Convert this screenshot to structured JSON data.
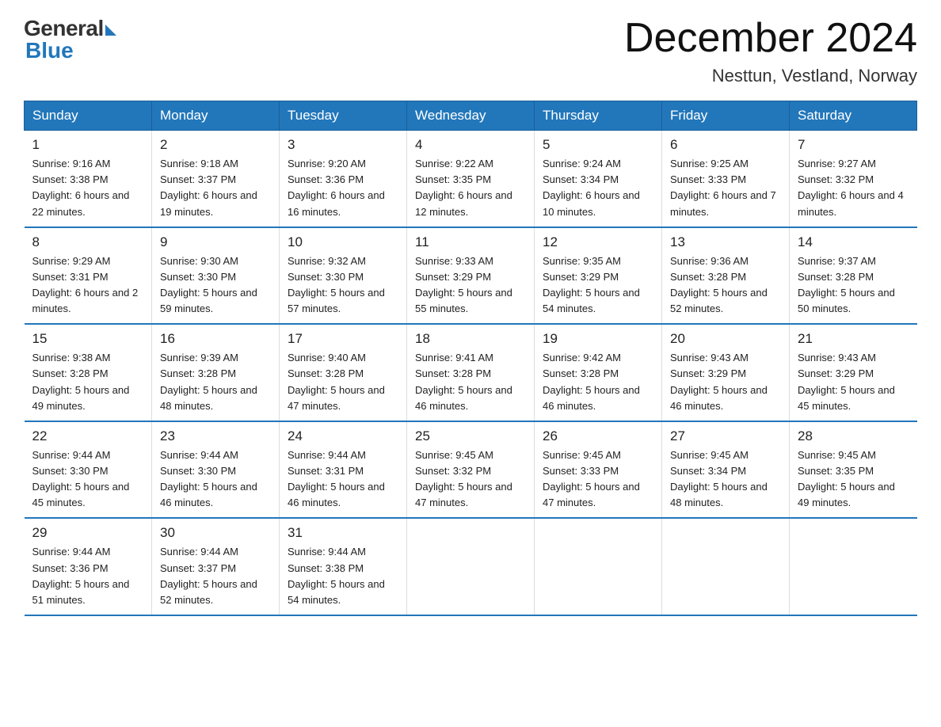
{
  "logo": {
    "general": "General",
    "blue": "Blue"
  },
  "title": "December 2024",
  "subtitle": "Nesttun, Vestland, Norway",
  "days_of_week": [
    "Sunday",
    "Monday",
    "Tuesday",
    "Wednesday",
    "Thursday",
    "Friday",
    "Saturday"
  ],
  "weeks": [
    [
      {
        "num": "1",
        "sunrise": "9:16 AM",
        "sunset": "3:38 PM",
        "daylight": "6 hours and 22 minutes."
      },
      {
        "num": "2",
        "sunrise": "9:18 AM",
        "sunset": "3:37 PM",
        "daylight": "6 hours and 19 minutes."
      },
      {
        "num": "3",
        "sunrise": "9:20 AM",
        "sunset": "3:36 PM",
        "daylight": "6 hours and 16 minutes."
      },
      {
        "num": "4",
        "sunrise": "9:22 AM",
        "sunset": "3:35 PM",
        "daylight": "6 hours and 12 minutes."
      },
      {
        "num": "5",
        "sunrise": "9:24 AM",
        "sunset": "3:34 PM",
        "daylight": "6 hours and 10 minutes."
      },
      {
        "num": "6",
        "sunrise": "9:25 AM",
        "sunset": "3:33 PM",
        "daylight": "6 hours and 7 minutes."
      },
      {
        "num": "7",
        "sunrise": "9:27 AM",
        "sunset": "3:32 PM",
        "daylight": "6 hours and 4 minutes."
      }
    ],
    [
      {
        "num": "8",
        "sunrise": "9:29 AM",
        "sunset": "3:31 PM",
        "daylight": "6 hours and 2 minutes."
      },
      {
        "num": "9",
        "sunrise": "9:30 AM",
        "sunset": "3:30 PM",
        "daylight": "5 hours and 59 minutes."
      },
      {
        "num": "10",
        "sunrise": "9:32 AM",
        "sunset": "3:30 PM",
        "daylight": "5 hours and 57 minutes."
      },
      {
        "num": "11",
        "sunrise": "9:33 AM",
        "sunset": "3:29 PM",
        "daylight": "5 hours and 55 minutes."
      },
      {
        "num": "12",
        "sunrise": "9:35 AM",
        "sunset": "3:29 PM",
        "daylight": "5 hours and 54 minutes."
      },
      {
        "num": "13",
        "sunrise": "9:36 AM",
        "sunset": "3:28 PM",
        "daylight": "5 hours and 52 minutes."
      },
      {
        "num": "14",
        "sunrise": "9:37 AM",
        "sunset": "3:28 PM",
        "daylight": "5 hours and 50 minutes."
      }
    ],
    [
      {
        "num": "15",
        "sunrise": "9:38 AM",
        "sunset": "3:28 PM",
        "daylight": "5 hours and 49 minutes."
      },
      {
        "num": "16",
        "sunrise": "9:39 AM",
        "sunset": "3:28 PM",
        "daylight": "5 hours and 48 minutes."
      },
      {
        "num": "17",
        "sunrise": "9:40 AM",
        "sunset": "3:28 PM",
        "daylight": "5 hours and 47 minutes."
      },
      {
        "num": "18",
        "sunrise": "9:41 AM",
        "sunset": "3:28 PM",
        "daylight": "5 hours and 46 minutes."
      },
      {
        "num": "19",
        "sunrise": "9:42 AM",
        "sunset": "3:28 PM",
        "daylight": "5 hours and 46 minutes."
      },
      {
        "num": "20",
        "sunrise": "9:43 AM",
        "sunset": "3:29 PM",
        "daylight": "5 hours and 46 minutes."
      },
      {
        "num": "21",
        "sunrise": "9:43 AM",
        "sunset": "3:29 PM",
        "daylight": "5 hours and 45 minutes."
      }
    ],
    [
      {
        "num": "22",
        "sunrise": "9:44 AM",
        "sunset": "3:30 PM",
        "daylight": "5 hours and 45 minutes."
      },
      {
        "num": "23",
        "sunrise": "9:44 AM",
        "sunset": "3:30 PM",
        "daylight": "5 hours and 46 minutes."
      },
      {
        "num": "24",
        "sunrise": "9:44 AM",
        "sunset": "3:31 PM",
        "daylight": "5 hours and 46 minutes."
      },
      {
        "num": "25",
        "sunrise": "9:45 AM",
        "sunset": "3:32 PM",
        "daylight": "5 hours and 47 minutes."
      },
      {
        "num": "26",
        "sunrise": "9:45 AM",
        "sunset": "3:33 PM",
        "daylight": "5 hours and 47 minutes."
      },
      {
        "num": "27",
        "sunrise": "9:45 AM",
        "sunset": "3:34 PM",
        "daylight": "5 hours and 48 minutes."
      },
      {
        "num": "28",
        "sunrise": "9:45 AM",
        "sunset": "3:35 PM",
        "daylight": "5 hours and 49 minutes."
      }
    ],
    [
      {
        "num": "29",
        "sunrise": "9:44 AM",
        "sunset": "3:36 PM",
        "daylight": "5 hours and 51 minutes."
      },
      {
        "num": "30",
        "sunrise": "9:44 AM",
        "sunset": "3:37 PM",
        "daylight": "5 hours and 52 minutes."
      },
      {
        "num": "31",
        "sunrise": "9:44 AM",
        "sunset": "3:38 PM",
        "daylight": "5 hours and 54 minutes."
      },
      null,
      null,
      null,
      null
    ]
  ],
  "labels": {
    "sunrise": "Sunrise:",
    "sunset": "Sunset:",
    "daylight": "Daylight:"
  }
}
